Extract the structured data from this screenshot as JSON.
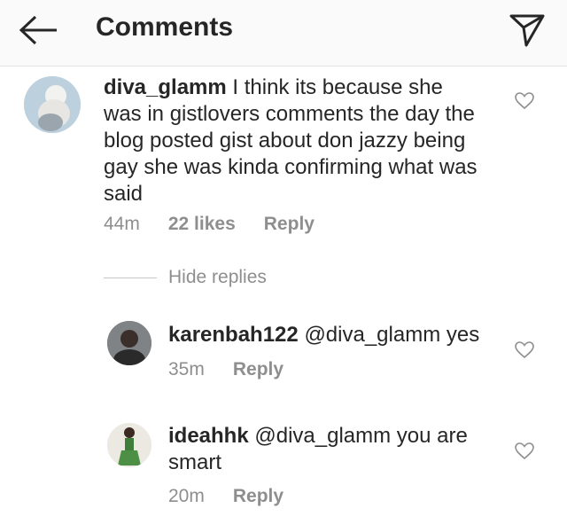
{
  "header": {
    "title": "Comments",
    "back_icon": "arrow-left-icon",
    "send_icon": "paper-plane-icon"
  },
  "comment": {
    "username": "diva_glamm",
    "text": "I think its because she was in gistlovers comments the day the blog posted gist about don jazzy being gay she was kinda confirming what was said",
    "lines": [
      "was in gistlovers comments the day the",
      "blog posted gist about don jazzy being",
      "gay she was kinda confirming what was",
      "said"
    ],
    "first_line_text": "I think its because she",
    "time": "44m",
    "likes": "22 likes",
    "reply_label": "Reply"
  },
  "hide_replies_label": "Hide replies",
  "replies": [
    {
      "username": "karenbah122",
      "mention": "@diva_glamm",
      "text": "yes",
      "time": "35m",
      "reply_label": "Reply"
    },
    {
      "username": "ideahhk",
      "mention": "@diva_glamm",
      "text": "you are",
      "text_line2": "smart",
      "time": "20m",
      "reply_label": "Reply"
    }
  ],
  "colors": {
    "text": "#262626",
    "muted": "#8e8e8e",
    "header_bg": "#fafafa"
  }
}
